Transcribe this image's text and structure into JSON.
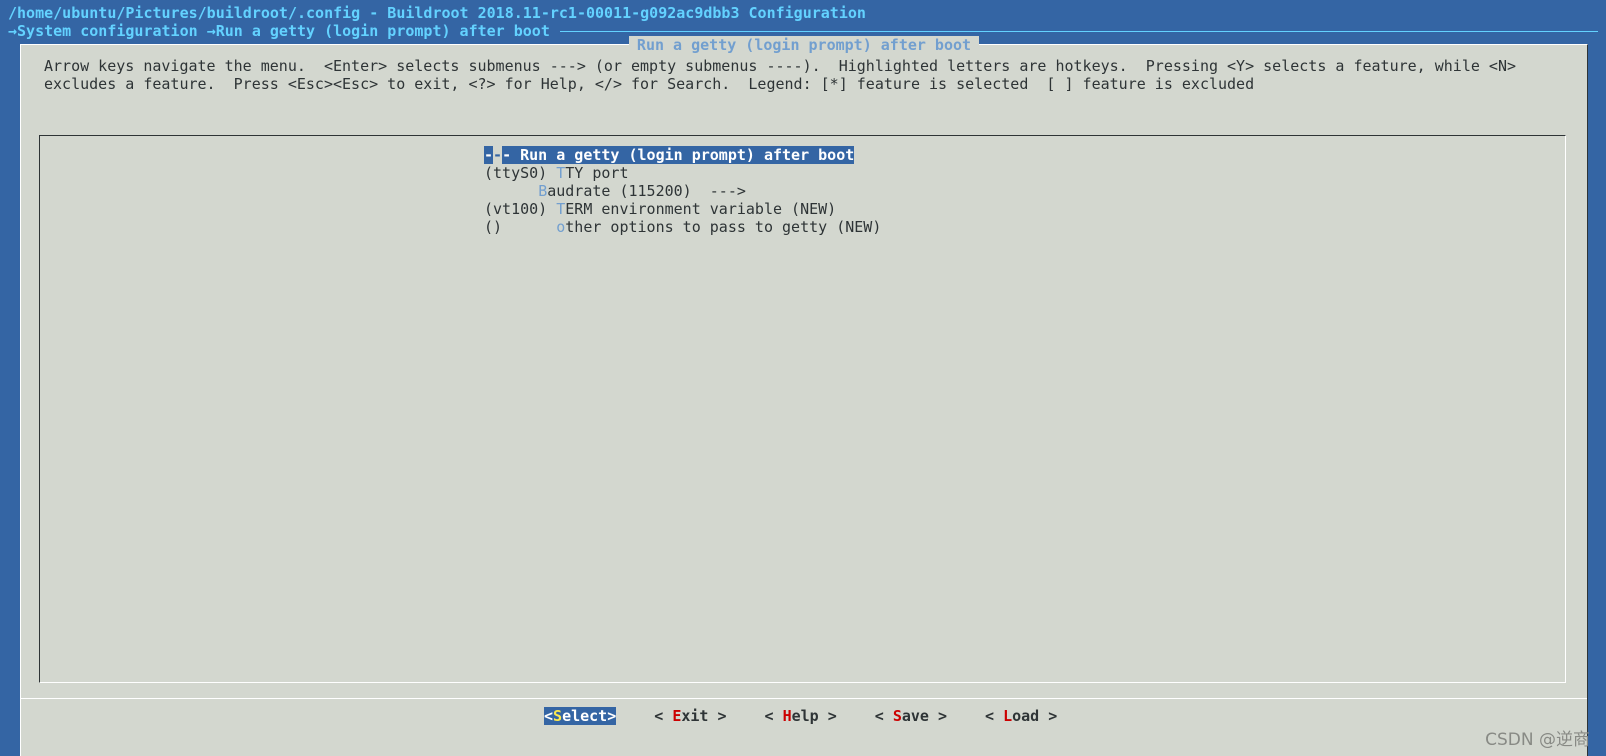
{
  "window": {
    "title": "/home/ubuntu/Pictures/buildroot/.config - Buildroot 2018.11-rc1-00011-g092ac9dbb3 Configuration"
  },
  "breadcrumb": {
    "arrow": "→",
    "parent": "System configuration",
    "current": "Run a getty (login prompt) after boot"
  },
  "dialog": {
    "title": "Run a getty (login prompt) after boot",
    "help_line1": "Arrow keys navigate the menu.  <Enter> selects submenus ---> (or empty submenus ----).  Highlighted letters are hotkeys.  Pressing <Y> selects a feature, while <N>",
    "help_line2": "excludes a feature.  Press <Esc><Esc> to exit, <?> for Help, </> for Search.  Legend: [*] feature is selected  [ ] feature is excluded"
  },
  "menu": {
    "items": [
      {
        "prefix": "-",
        "cursor": "-",
        "pre": "- ",
        "hot": "",
        "rest": "Run a getty (login prompt) after boot"
      },
      {
        "pre": "(ttyS0) ",
        "hot": "T",
        "rest": "TY port"
      },
      {
        "pre": "      ",
        "hot": "B",
        "rest": "audrate (115200)  --->"
      },
      {
        "pre": "(vt100) ",
        "hot": "T",
        "rest": "ERM environment variable (NEW)"
      },
      {
        "pre": "()      ",
        "hot": "o",
        "rest": "ther options to pass to getty (NEW)"
      }
    ]
  },
  "buttons": [
    {
      "open": "<",
      "key": "S",
      "rest": "elect",
      "close": ">"
    },
    {
      "open": "< ",
      "key": "E",
      "rest": "xit",
      "close": " >"
    },
    {
      "open": "< ",
      "key": "H",
      "rest": "elp",
      "close": " >"
    },
    {
      "open": "< ",
      "key": "S",
      "rest": "ave",
      "close": " >"
    },
    {
      "open": "< ",
      "key": "L",
      "rest": "oad",
      "close": " >"
    }
  ],
  "watermark": "CSDN @逆商",
  "colors": {
    "background": "#3465a4",
    "dialog": "#d3d7cf",
    "title_text": "#63d2ff",
    "hotkey": "#729fcf",
    "button_key": "#cc0000"
  }
}
